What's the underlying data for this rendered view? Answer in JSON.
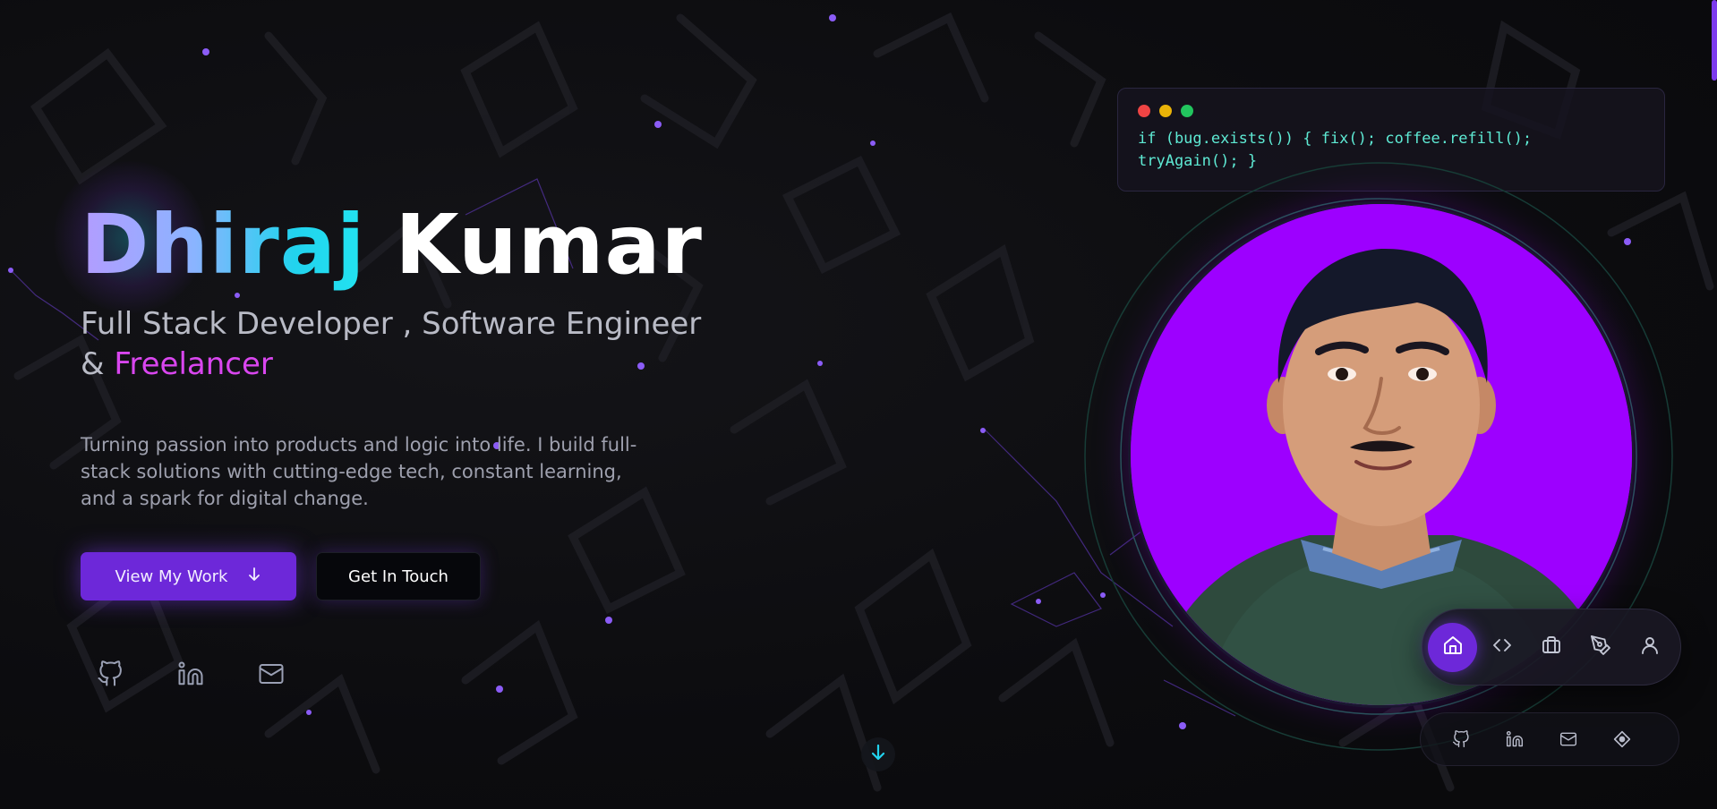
{
  "hero": {
    "first_name": "Dhiraj",
    "last_name": "Kumar",
    "subtitle_main": "Full Stack Developer , Software Engineer",
    "subtitle_amp": "&",
    "subtitle_highlight": "Freelancer",
    "description": "Turning passion into products and logic into life. I build full-stack solutions with cutting-edge tech, constant learning, and a spark for digital change.",
    "primary_button": "View My Work",
    "primary_button_icon": "arrow-down-icon",
    "secondary_button": "Get In Touch",
    "socials": [
      {
        "name": "github-icon"
      },
      {
        "name": "linkedin-icon"
      },
      {
        "name": "mail-icon"
      }
    ]
  },
  "code_card": {
    "dot_colors": [
      "#ef4444",
      "#eab308",
      "#22c55e"
    ],
    "line1": "if (bug.exists()) { fix(); coffee.refill();",
    "line2": "tryAgain(); }"
  },
  "nav": {
    "items": [
      {
        "name": "home-icon",
        "active": true
      },
      {
        "name": "code-icon",
        "active": false
      },
      {
        "name": "briefcase-icon",
        "active": false
      },
      {
        "name": "pen-tool-icon",
        "active": false
      },
      {
        "name": "user-icon",
        "active": false
      }
    ]
  },
  "social_bar": {
    "items": [
      {
        "name": "github-icon"
      },
      {
        "name": "linkedin-icon"
      },
      {
        "name": "mail-icon"
      },
      {
        "name": "diamond-icon"
      }
    ]
  },
  "scroll_indicator": {
    "icon": "arrow-down-icon"
  },
  "colors": {
    "accent": "#6d28d9",
    "cyan": "#22d3ee",
    "highlight": "#d946ef",
    "portrait_bg": "#9d00ff",
    "background": "#0b0b0d"
  }
}
